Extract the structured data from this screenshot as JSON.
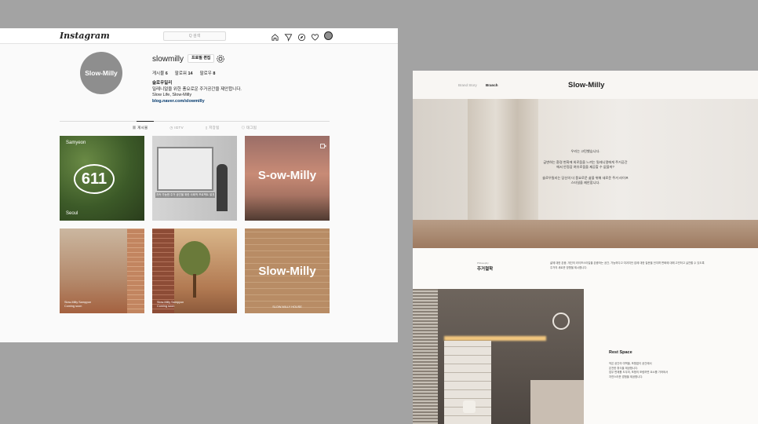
{
  "instagram": {
    "logo": "Instagram",
    "search_placeholder": "Q 검색",
    "nav_icons": [
      "home-icon",
      "direct-icon",
      "explore-icon",
      "heart-icon",
      "profile-avatar-icon"
    ],
    "profile": {
      "avatar_text": "Slow-Milly",
      "username": "slowmilly",
      "edit_button": "프로필 편집",
      "stats": {
        "posts_label": "게시물",
        "posts_value": "6",
        "followers_label": "팔로워",
        "followers_value": "14",
        "following_label": "팔로우",
        "following_value": "8"
      },
      "bio_name": "슬로우밀리",
      "bio_lines": [
        "밀레니얼을 위한 풍요로운 주거공간을 제안합니다.",
        "Slow Life, Slow-Milly"
      ],
      "bio_link": "blog.naver.com/slowmilly"
    },
    "tabs": [
      "게시물",
      "IGTV",
      "저장됨",
      "태그됨"
    ],
    "posts": [
      {
        "title": "Samyeon",
        "number": "611",
        "subtitle": "Seoul"
      },
      {
        "caption": "지속 가능한 주거 공간을 위한 사회적 프로젝트 발표"
      },
      {
        "word": "S-ow-Milly"
      },
      {
        "caption_line1": "Slow-Milly Sampyon",
        "caption_line2": "Coming soon"
      },
      {
        "caption_line1": "Slow-Milly Sampyon",
        "caption_line2": "Coming soon"
      },
      {
        "word": "Slow-Milly",
        "caption": "SLOW-MILLY HOUSE"
      }
    ]
  },
  "website": {
    "nav": {
      "brand_story": "Brand Story",
      "branch": "Branch"
    },
    "logo": "Slow-Milly",
    "hero_paragraphs": [
      "우리는 고민했습니다.",
      "급변하는 환경 변화에 외로움을 느끼는 밀레니얼에게 주거공간에서 안정감 여유로움을 제공할 수 없을까?",
      "슬로우밀리는 당신의 더 풍요로운 삶을 위해 새로운 주거 라이프스타일을 제안합니다."
    ],
    "philosophy": {
      "label_en": "Philosophy",
      "label_ko": "주거철학",
      "text": "삶에 대한 존중, 개인의 라이프스타일을 존중하는 공간, 가능하다고 여겨지던 집에 대한 질문을 던지며 변화에 대해 고민하고 실천할 수 있도록 주거의 새로운 방향을 제시합니다."
    },
    "rest_space": {
      "title": "Rest Space",
      "lines": [
        "작은 공간의 여백을, 포함없이 공간에서",
        "온전한 휴식을 제공합니다.",
        "업무 면제를 도우미, 포함의 포럼하면 요소를 가져와서",
        "자연스러운 경험을 제공합니다."
      ]
    }
  }
}
